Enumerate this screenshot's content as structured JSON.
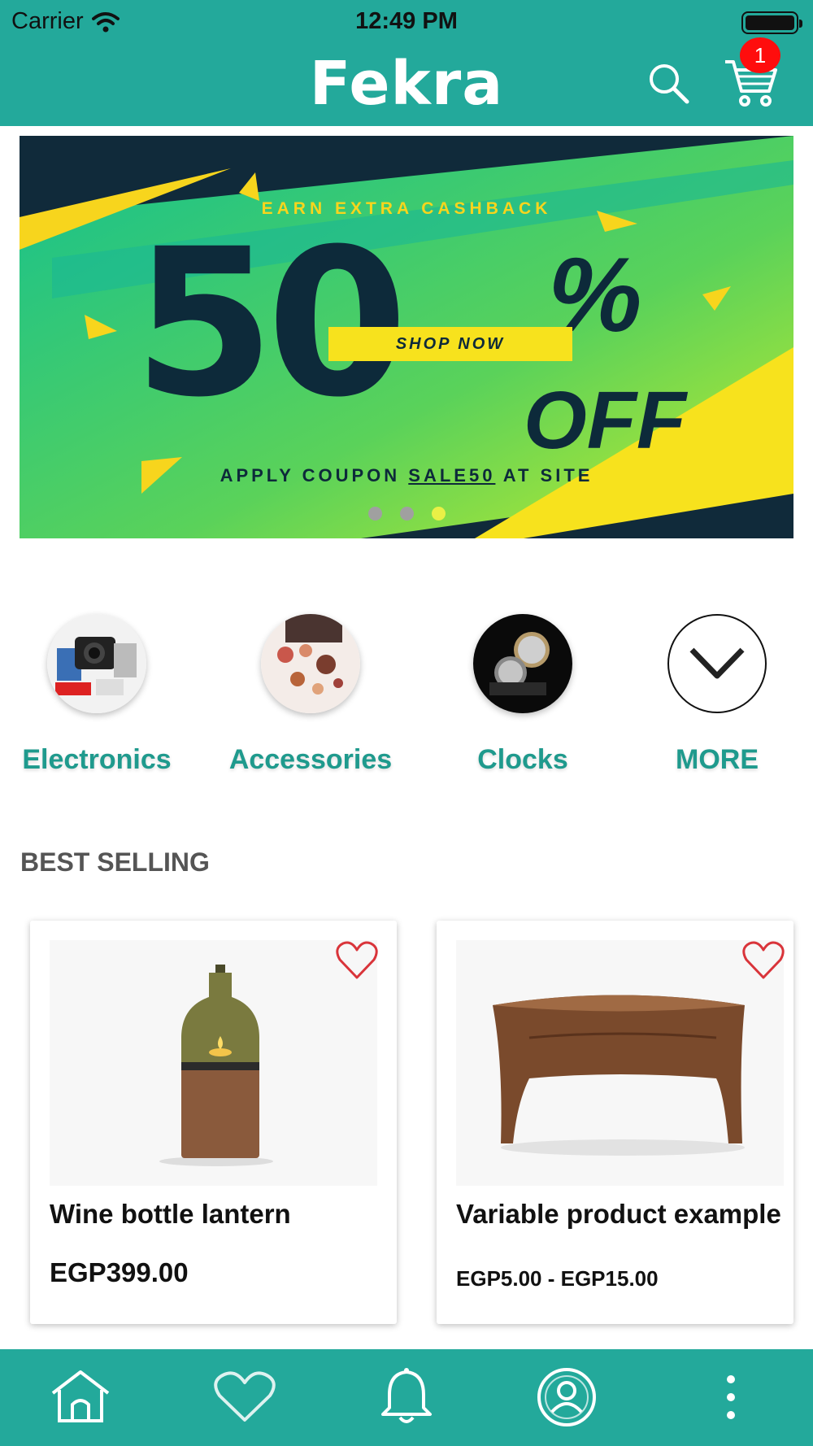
{
  "status_bar": {
    "carrier": "Carrier",
    "time": "12:49 PM"
  },
  "header": {
    "logo": "Fekra",
    "cart_count": "1"
  },
  "banner": {
    "top_text": "EARN EXTRA CASHBACK",
    "big_number": "50",
    "percent": "%",
    "off": "OFF",
    "shop_now": "SHOP NOW",
    "bottom_pre": "APPLY COUPON ",
    "coupon": "SALE50",
    "bottom_post": " AT SITE",
    "slide_count": 3,
    "active_slide": 3,
    "colors": {
      "green": "#1fbf8c",
      "yellow": "#f7e21d",
      "navy": "#0d2a3a"
    }
  },
  "categories": [
    {
      "label": "Electronics",
      "icon": "electronics-image"
    },
    {
      "label": "Accessories",
      "icon": "accessories-image"
    },
    {
      "label": "Clocks",
      "icon": "clocks-image"
    },
    {
      "label": "MORE",
      "icon": "chevron-down-icon"
    }
  ],
  "best_selling": {
    "title": "BEST SELLING",
    "products": [
      {
        "name": "Wine bottle lantern",
        "price": "EGP399.00"
      },
      {
        "name": "Variable product example",
        "price": "EGP5.00 - EGP15.00"
      }
    ]
  },
  "tabbar": {
    "items": [
      "home-icon",
      "heart-icon",
      "bell-icon",
      "profile-icon",
      "more-vertical-icon"
    ]
  },
  "theme": {
    "primary": "#23a99b",
    "accent_text": "#1f9a8d",
    "badge": "#ff0d0d",
    "favorite": "#d9343a"
  }
}
